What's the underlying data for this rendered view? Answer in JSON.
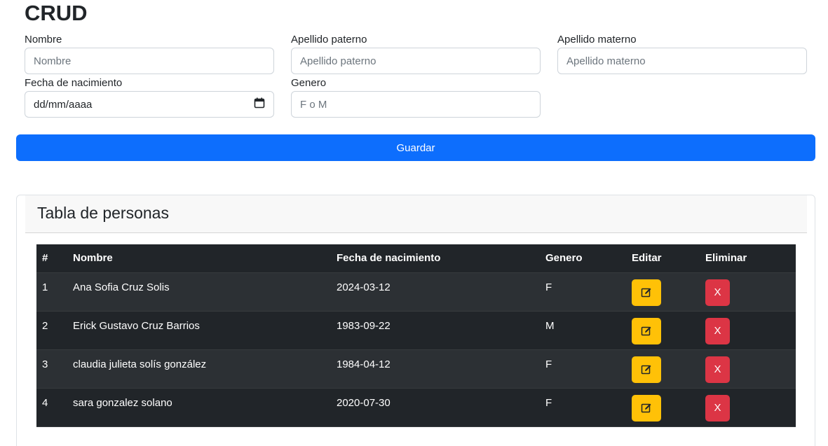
{
  "app": {
    "title": "CRUD"
  },
  "form": {
    "nombre": {
      "label": "Nombre",
      "placeholder": "Nombre",
      "value": ""
    },
    "apellido_paterno": {
      "label": "Apellido paterno",
      "placeholder": "Apellido paterno",
      "value": ""
    },
    "apellido_materno": {
      "label": "Apellido materno",
      "placeholder": "Apellido materno",
      "value": ""
    },
    "fecha_nacimiento": {
      "label": "Fecha de nacimiento",
      "placeholder": "dd/mm/aaaa",
      "icon": "calendar-icon"
    },
    "genero": {
      "label": "Genero",
      "placeholder": "F o M",
      "value": ""
    },
    "save_label": "Guardar"
  },
  "table_card": {
    "title": "Tabla de personas",
    "headers": [
      "#",
      "Nombre",
      "Fecha de nacimiento",
      "Genero",
      "Editar",
      "Eliminar"
    ],
    "rows": [
      {
        "num": "1",
        "nombre": "Ana Sofia Cruz Solis",
        "fecha": "2024-03-12",
        "genero": "F",
        "delete_label": "X"
      },
      {
        "num": "2",
        "nombre": "Erick Gustavo Cruz Barrios",
        "fecha": "1983-09-22",
        "genero": "M",
        "delete_label": "X"
      },
      {
        "num": "3",
        "nombre": "claudia julieta solís gonzález",
        "fecha": "1984-04-12",
        "genero": "F",
        "delete_label": "X"
      },
      {
        "num": "4",
        "nombre": "sara gonzalez solano",
        "fecha": "2020-07-30",
        "genero": "F",
        "delete_label": "X"
      }
    ],
    "edit_icon": "edit-icon"
  },
  "colors": {
    "primary": "#0d6efd",
    "warning": "#ffc107",
    "danger": "#dc3545",
    "table_dark": "#212529",
    "table_stripe": "#2c3034"
  }
}
